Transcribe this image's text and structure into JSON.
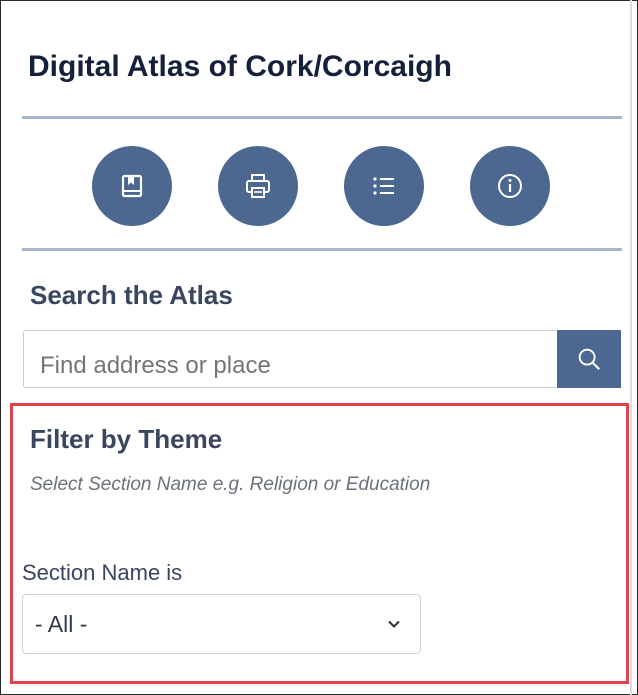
{
  "app": {
    "title": "Digital Atlas of Cork/Corcaigh"
  },
  "toolbar": {
    "buttons": [
      {
        "icon": "bookmark-icon"
      },
      {
        "icon": "print-icon"
      },
      {
        "icon": "list-icon"
      },
      {
        "icon": "info-icon"
      }
    ]
  },
  "search": {
    "heading": "Search the Atlas",
    "placeholder": "Find address or place",
    "button_icon": "search-icon"
  },
  "filter": {
    "heading": "Filter by Theme",
    "hint": "Select Section Name e.g. Religion or Education",
    "field_label": "Section Name is",
    "selected_value": "- All -"
  },
  "colors": {
    "accent": "#4c6891",
    "highlight_border": "#e0434a",
    "divider": "#a8b4c8"
  }
}
